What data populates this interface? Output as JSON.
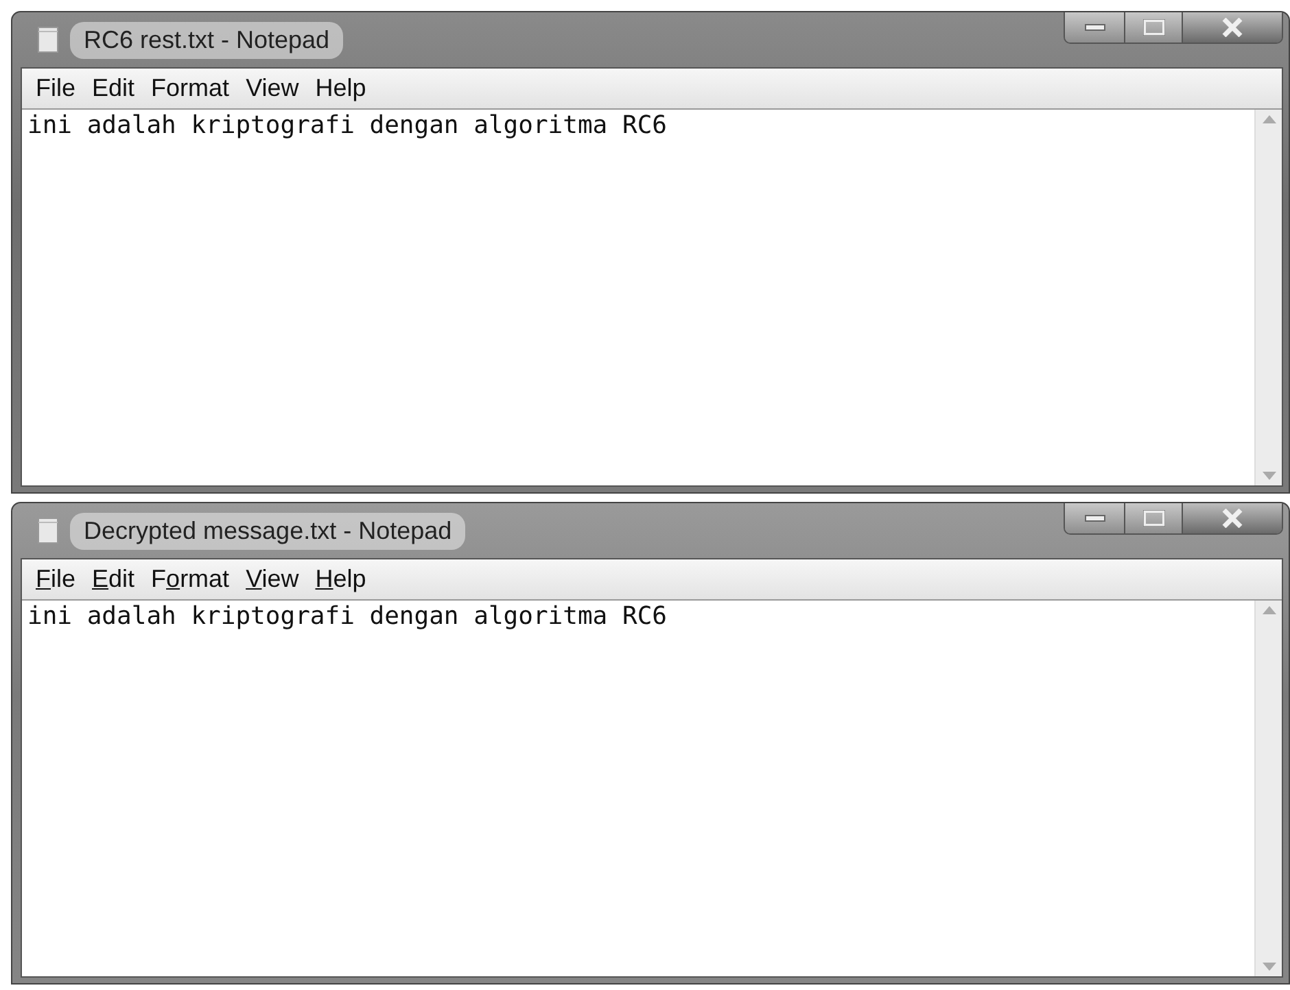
{
  "windows": [
    {
      "title": "RC6 rest.txt - Notepad",
      "active": false,
      "menu": [
        {
          "label": "File"
        },
        {
          "label": "Edit"
        },
        {
          "label": "Format"
        },
        {
          "label": "View"
        },
        {
          "label": "Help"
        }
      ],
      "text": "ini adalah kriptografi dengan algoritma RC6"
    },
    {
      "title": "Decrypted message.txt - Notepad",
      "active": true,
      "menu": [
        {
          "access_key": "F",
          "label_rest": "ile"
        },
        {
          "access_key": "E",
          "label_rest": "dit"
        },
        {
          "label_start": "F",
          "access_key": "o",
          "label_rest": "rmat"
        },
        {
          "access_key": "V",
          "label_rest": "iew"
        },
        {
          "access_key": "H",
          "label_rest": "elp"
        }
      ],
      "text": "ini adalah kriptografi dengan algoritma RC6"
    }
  ]
}
